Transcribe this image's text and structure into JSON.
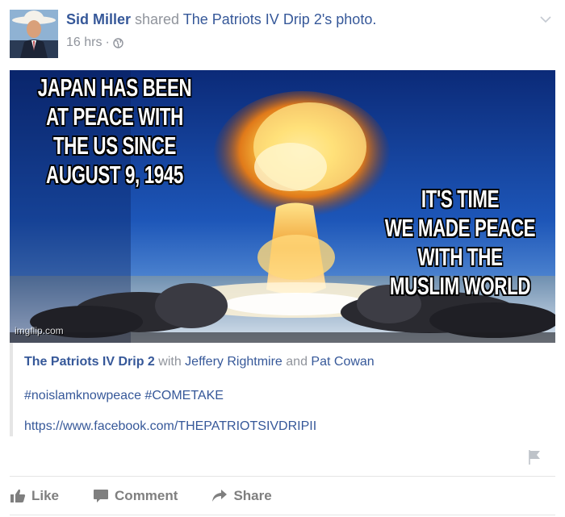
{
  "post": {
    "author": "Sid Miller",
    "action_text": "shared",
    "shared_from": "The Patriots IV Drip 2",
    "shared_suffix": "'s photo.",
    "timestamp": "16 hrs",
    "separator": "·",
    "privacy_icon": "globe-icon",
    "menu_icon": "chevron-down-icon"
  },
  "photo": {
    "left_text": [
      "JAPAN HAS BEEN",
      "AT PEACE WITH",
      "THE US SINCE",
      "AUGUST 9, 1945"
    ],
    "right_text": [
      "IT'S TIME",
      "WE MADE PEACE",
      "WITH THE",
      "MUSLIM WORLD"
    ],
    "watermark": "imgflip.com"
  },
  "shared_post": {
    "page_name": "The Patriots IV Drip 2",
    "with_text": "with",
    "tagged_1": "Jeffery Rightmire",
    "and_text": "and",
    "tagged_2": "Pat Cowan",
    "hashtags": "#noislamknowpeace #COMETAKE",
    "url": "https://www.facebook.com/THEPATRIOTSIVDRIPII",
    "flag_icon": "flag-icon"
  },
  "actions": {
    "like": "Like",
    "comment": "Comment",
    "share": "Share"
  },
  "colors": {
    "link": "#365899",
    "muted": "#90949c",
    "action": "#7f7f7f"
  }
}
